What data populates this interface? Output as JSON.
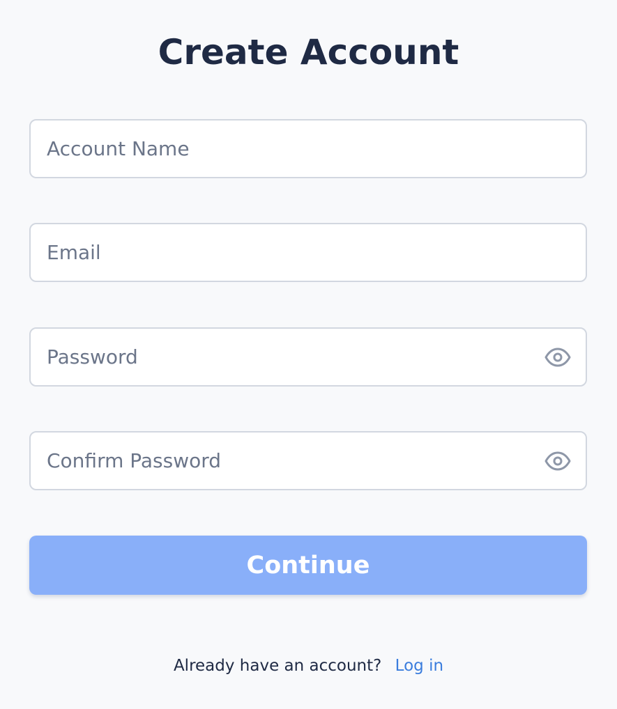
{
  "title": "Create Account",
  "fields": {
    "account_name": {
      "placeholder": "Account Name",
      "value": ""
    },
    "email": {
      "placeholder": "Email",
      "value": ""
    },
    "password": {
      "placeholder": "Password",
      "value": "",
      "toggle_icon": "eye-icon"
    },
    "confirm_password": {
      "placeholder": "Confirm Password",
      "value": "",
      "toggle_icon": "eye-icon"
    }
  },
  "continue_button": {
    "label": "Continue",
    "color": "#89aff9"
  },
  "footer": {
    "prompt": "Already have an account?",
    "login_link": "Log in",
    "link_color": "#3b7ddd"
  },
  "colors": {
    "background": "#f8f9fb",
    "title": "#1f2a44",
    "placeholder": "#6b7589",
    "border": "#d2d7e0",
    "icon": "#8e97a8"
  }
}
